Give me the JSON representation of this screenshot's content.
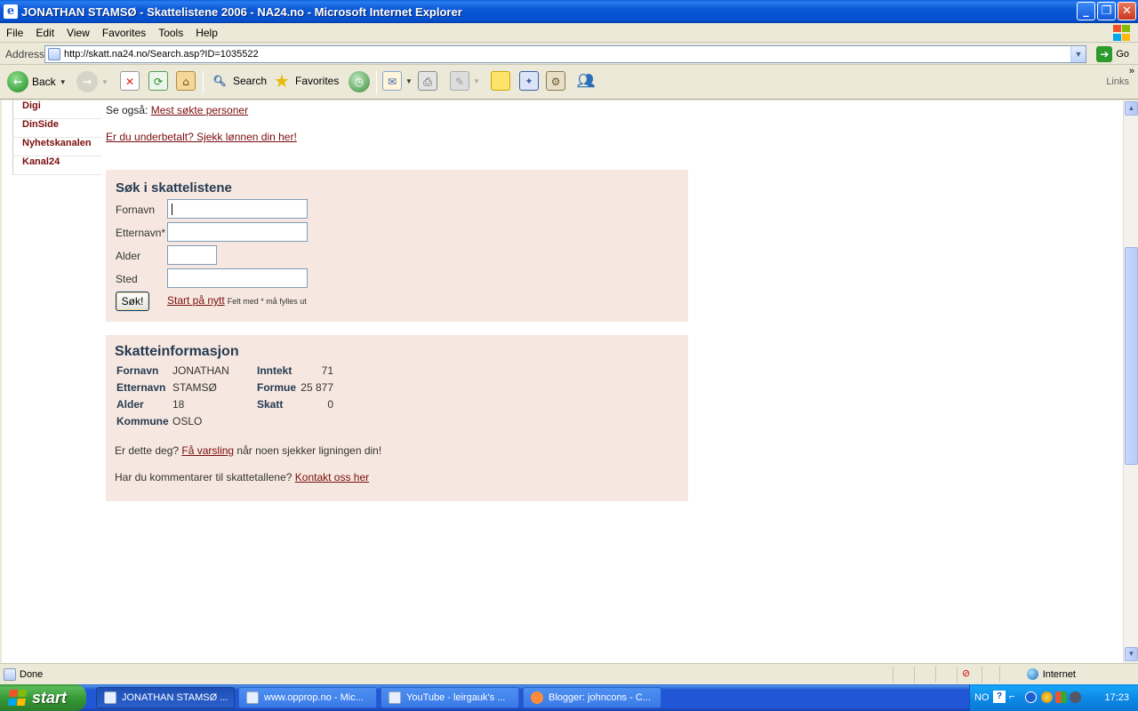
{
  "window": {
    "title": "JONATHAN STAMSØ - Skattelistene 2006 - NA24.no - Microsoft Internet Explorer",
    "controls": {
      "minimize": "_",
      "maximize": "❐",
      "close": "✕"
    }
  },
  "menu": [
    "File",
    "Edit",
    "View",
    "Favorites",
    "Tools",
    "Help"
  ],
  "address": {
    "label": "Address",
    "url": "http://skatt.na24.no/Search.asp?ID=1035522",
    "go_label": "Go"
  },
  "toolbar": {
    "back": "Back",
    "search": "Search",
    "favorites": "Favorites",
    "links": "Links"
  },
  "sidebar": {
    "items": [
      "Digi",
      "DinSide",
      "Nyhetskanalen",
      "Kanal24"
    ]
  },
  "page": {
    "see_also_prefix": "Se også: ",
    "see_also_link": "Mest søkte personer",
    "underpaid_link": "Er du underbetalt? Sjekk lønnen din her!"
  },
  "search_form": {
    "title": "Søk i skattelistene",
    "labels": {
      "first_name": "Fornavn",
      "last_name": "Etternavn*",
      "age": "Alder",
      "place": "Sted"
    },
    "values": {
      "first_name": "",
      "last_name": "",
      "age": "",
      "place": ""
    },
    "submit": "Søk!",
    "restart_link": "Start på nytt",
    "required_note": "Felt med * må fylles ut"
  },
  "tax_info": {
    "title": "Skatteinformasjon",
    "labels": {
      "first_name": "Fornavn",
      "last_name": "Etternavn",
      "age": "Alder",
      "municipality": "Kommune",
      "income": "Inntekt",
      "wealth": "Formue",
      "tax": "Skatt"
    },
    "values": {
      "first_name": "JONATHAN",
      "last_name": "STAMSØ",
      "age": "18",
      "municipality": "OSLO",
      "income": "71",
      "wealth": "25 877",
      "tax": "0"
    },
    "alert_prefix": "Er dette deg? ",
    "alert_link": "Få varsling",
    "alert_suffix": " når noen sjekker ligningen din!",
    "comment_prefix": "Har du kommentarer til skattetallene? ",
    "comment_link": "Kontakt oss her"
  },
  "statusbar": {
    "status": "Done",
    "zone": "Internet"
  },
  "taskbar": {
    "start": "start",
    "tasks": [
      "JONATHAN STAMSØ ...",
      "www.opprop.no - Mic...",
      "YouTube - leirgauk's ...",
      "Blogger: johncons - C..."
    ],
    "language": "NO",
    "help": "?",
    "clock": "17:23"
  }
}
